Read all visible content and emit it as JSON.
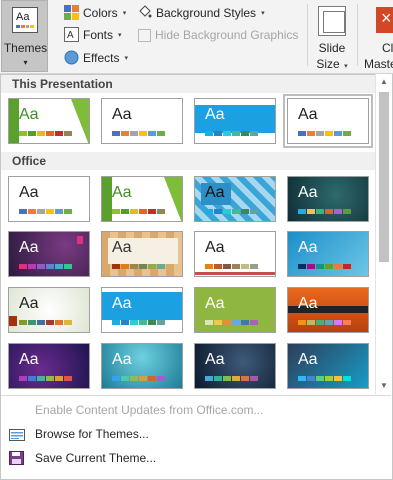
{
  "ribbon": {
    "themes_label": "Themes",
    "colors_label": "Colors",
    "fonts_label": "Fonts",
    "effects_label": "Effects",
    "background_styles_label": "Background Styles",
    "hide_background_label": "Hide Background Graphics",
    "slide_size_line1": "Slide",
    "slide_size_line2": "Size",
    "master_line1": "Cl",
    "master_line2": "Maste"
  },
  "gallery": {
    "section_this_presentation": "This Presentation",
    "section_office": "Office",
    "thumb_text": "Aa",
    "colors": {
      "accent": "#b7b7b7",
      "section_bg": "#f0f0f0"
    }
  },
  "menu": {
    "enable_updates": "Enable Content Updates from Office.com...",
    "browse": "Browse for Themes...",
    "save": "Save Current Theme..."
  }
}
